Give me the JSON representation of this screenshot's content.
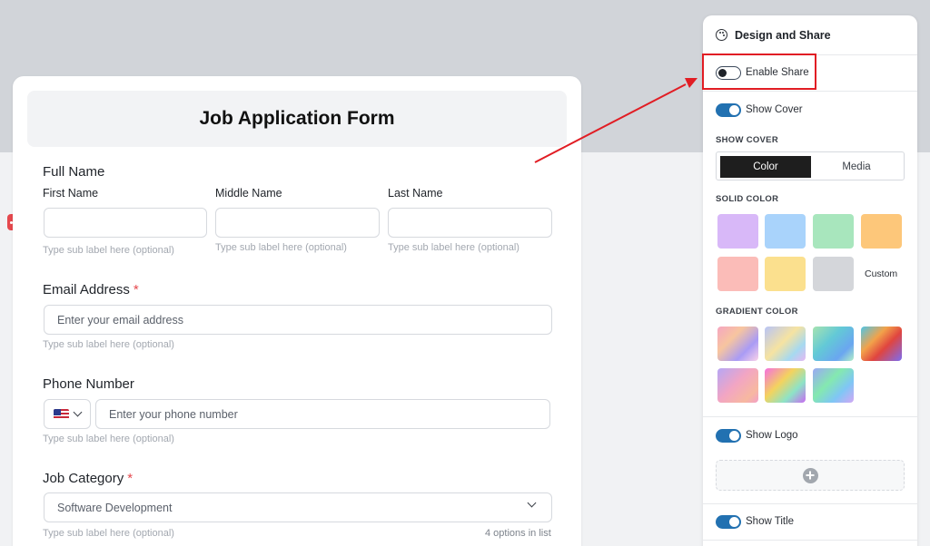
{
  "form": {
    "title": "Job Application Form",
    "full_name": {
      "label": "Full Name",
      "first": {
        "label": "First Name",
        "value": "",
        "sublabel": "Type sub label here (optional)"
      },
      "middle": {
        "label": "Middle Name",
        "value": "",
        "sublabel": "Type sub label here (optional)"
      },
      "last": {
        "label": "Last Name",
        "value": "",
        "sublabel": "Type sub label here (optional)"
      }
    },
    "email": {
      "label": "Email Address",
      "required": "*",
      "placeholder": "Enter your email address",
      "sublabel": "Type sub label here (optional)"
    },
    "phone": {
      "label": "Phone Number",
      "country_icon": "us-flag-icon",
      "placeholder": "Enter your phone number",
      "sublabel": "Type sub label here (optional)"
    },
    "category": {
      "label": "Job Category",
      "required": "*",
      "value": "Software Development",
      "sublabel": "Type sub label here (optional)",
      "options_hint": "4 options in list"
    }
  },
  "panel": {
    "title": "Design and Share",
    "title_icon": "palette-icon",
    "enable_share": {
      "label": "Enable Share",
      "state": "off"
    },
    "show_cover": {
      "label": "Show Cover",
      "state": "on"
    },
    "cover_section_label": "SHOW COVER",
    "cover_tabs": [
      {
        "label": "Color",
        "active": true
      },
      {
        "label": "Media",
        "active": false
      }
    ],
    "solid_color_label": "SOLID COLOR",
    "solid_colors": [
      "#d8b8f8",
      "#a9d3fb",
      "#a8e6bd",
      "#fdc77a",
      "#fbbcb8",
      "#fbe08e",
      "#d4d6da"
    ],
    "custom_label": "Custom",
    "gradient_color_label": "GRADIENT COLOR",
    "show_logo": {
      "label": "Show Logo",
      "state": "on"
    },
    "logo_add_icon": "plus-circle-icon",
    "show_title": {
      "label": "Show Title",
      "state": "on"
    }
  },
  "annotation": {
    "highlight_color": "#e11d24"
  }
}
